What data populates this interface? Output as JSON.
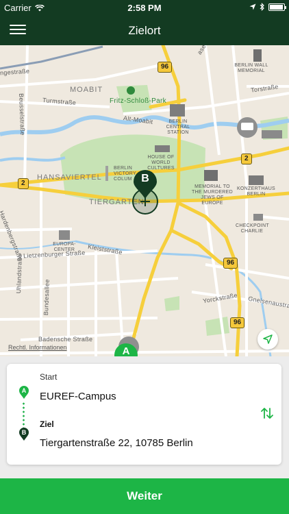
{
  "status_bar": {
    "carrier": "Carrier",
    "time": "2:58 PM",
    "battery_level": 0.95,
    "icons": [
      "wifi-icon",
      "location-arrow-icon",
      "bluetooth-icon",
      "battery-icon"
    ]
  },
  "nav": {
    "title": "Zielort",
    "menu_icon": "hamburger-menu-icon"
  },
  "map": {
    "districts": [
      "MOABIT",
      "HANSAVIERTEL",
      "TIERGARTEN"
    ],
    "streets": [
      "ngestraße",
      "Beusselstraße",
      "Turmstraße",
      "Alt-Moabit",
      "Torstraße",
      "Lietzenburger Straße",
      "Kleiststraße",
      "Hardenbergstraße",
      "Uhlandstraße",
      "Bundesallee",
      "Badensche Straße",
      "Yorckstraße",
      "Gneisenaustra",
      "aseestraße"
    ],
    "parks": [
      "Fritz-Schloß-Park"
    ],
    "pois": {
      "berlin_wall": "BERLIN WALL MEMORIAL",
      "central_station": "BERLIN CENTRAL STATION",
      "house_of_cultures": "HOUSE OF WORLD CULTURES",
      "victory_column": "BERLIN VICTORY COLUM",
      "memorial_jews": "MEMORIAL TO THE MURDERED JEWS OF EUROPE",
      "konzerthaus": "KONZERTHAUS BERLIN",
      "checkpoint": "CHECKPOINT CHARLIE",
      "europa_center": "EUROPA-CENTER"
    },
    "road_shields": [
      "96",
      "2",
      "2",
      "96",
      "96"
    ],
    "legal_link": "Rechtl. Informationen",
    "pins": {
      "start": "A",
      "destination": "B"
    },
    "colors": {
      "road": "#f6cf3c",
      "water": "#9ecdf0",
      "park": "#c7e3b5",
      "pin_dark": "#133b22",
      "pin_green": "#1db546"
    }
  },
  "route": {
    "start_caption": "Start",
    "start_value": "EUREF-Campus",
    "start_marker": "A",
    "destination_caption": "Ziel",
    "destination_value": "Tiergartenstraße 22, 10785 Berlin",
    "destination_marker": "B",
    "swap_icon": "swap-arrows-icon"
  },
  "actions": {
    "continue_label": "Weiter",
    "accent": "#1db546"
  }
}
